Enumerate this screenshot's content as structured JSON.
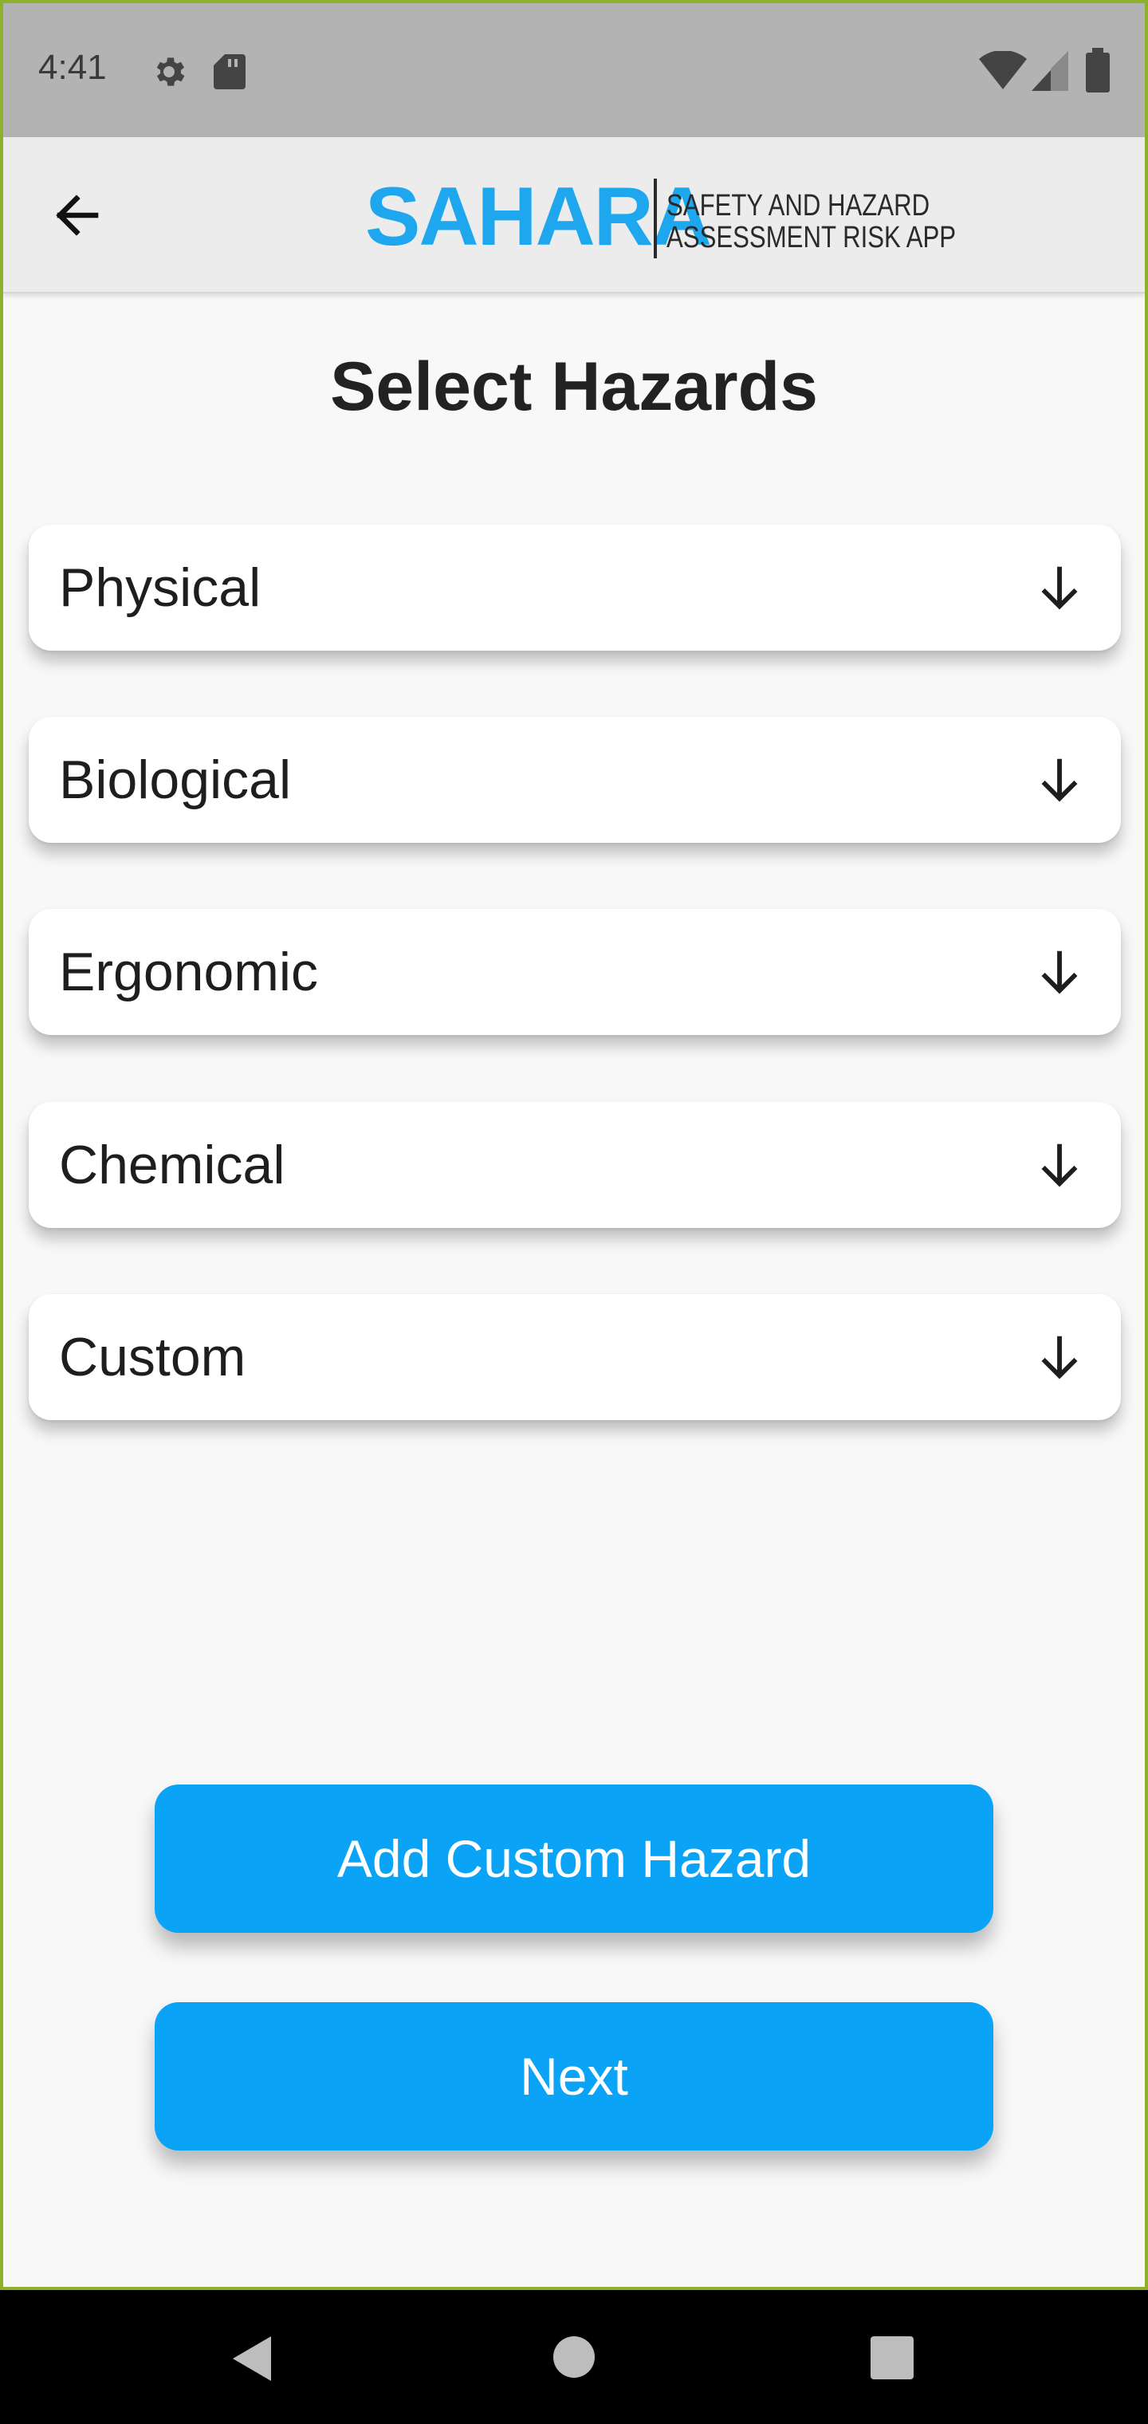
{
  "status_bar": {
    "time": "4:41",
    "icons": [
      "gear-icon",
      "sd-card-icon",
      "wifi-icon",
      "signal-icon",
      "battery-icon"
    ]
  },
  "header": {
    "back_icon": "arrow-left-icon",
    "logo_text": "SAHARA",
    "tagline_line1": "SAFETY AND HAZARD",
    "tagline_line2": "ASSESSMENT RISK APP",
    "logo_color": "#1ea7ee"
  },
  "main": {
    "title": "Select Hazards",
    "categories": [
      {
        "label": "Physical",
        "icon": "arrow-down-icon"
      },
      {
        "label": "Biological",
        "icon": "arrow-down-icon"
      },
      {
        "label": "Ergonomic",
        "icon": "arrow-down-icon"
      },
      {
        "label": "Chemical",
        "icon": "arrow-down-icon"
      },
      {
        "label": "Custom",
        "icon": "arrow-down-icon"
      }
    ],
    "add_custom_label": "Add Custom Hazard",
    "next_label": "Next",
    "accent_color": "#0aa3f5"
  },
  "nav_bar": {
    "icons": [
      "back-triangle-icon",
      "home-circle-icon",
      "recents-square-icon"
    ]
  }
}
